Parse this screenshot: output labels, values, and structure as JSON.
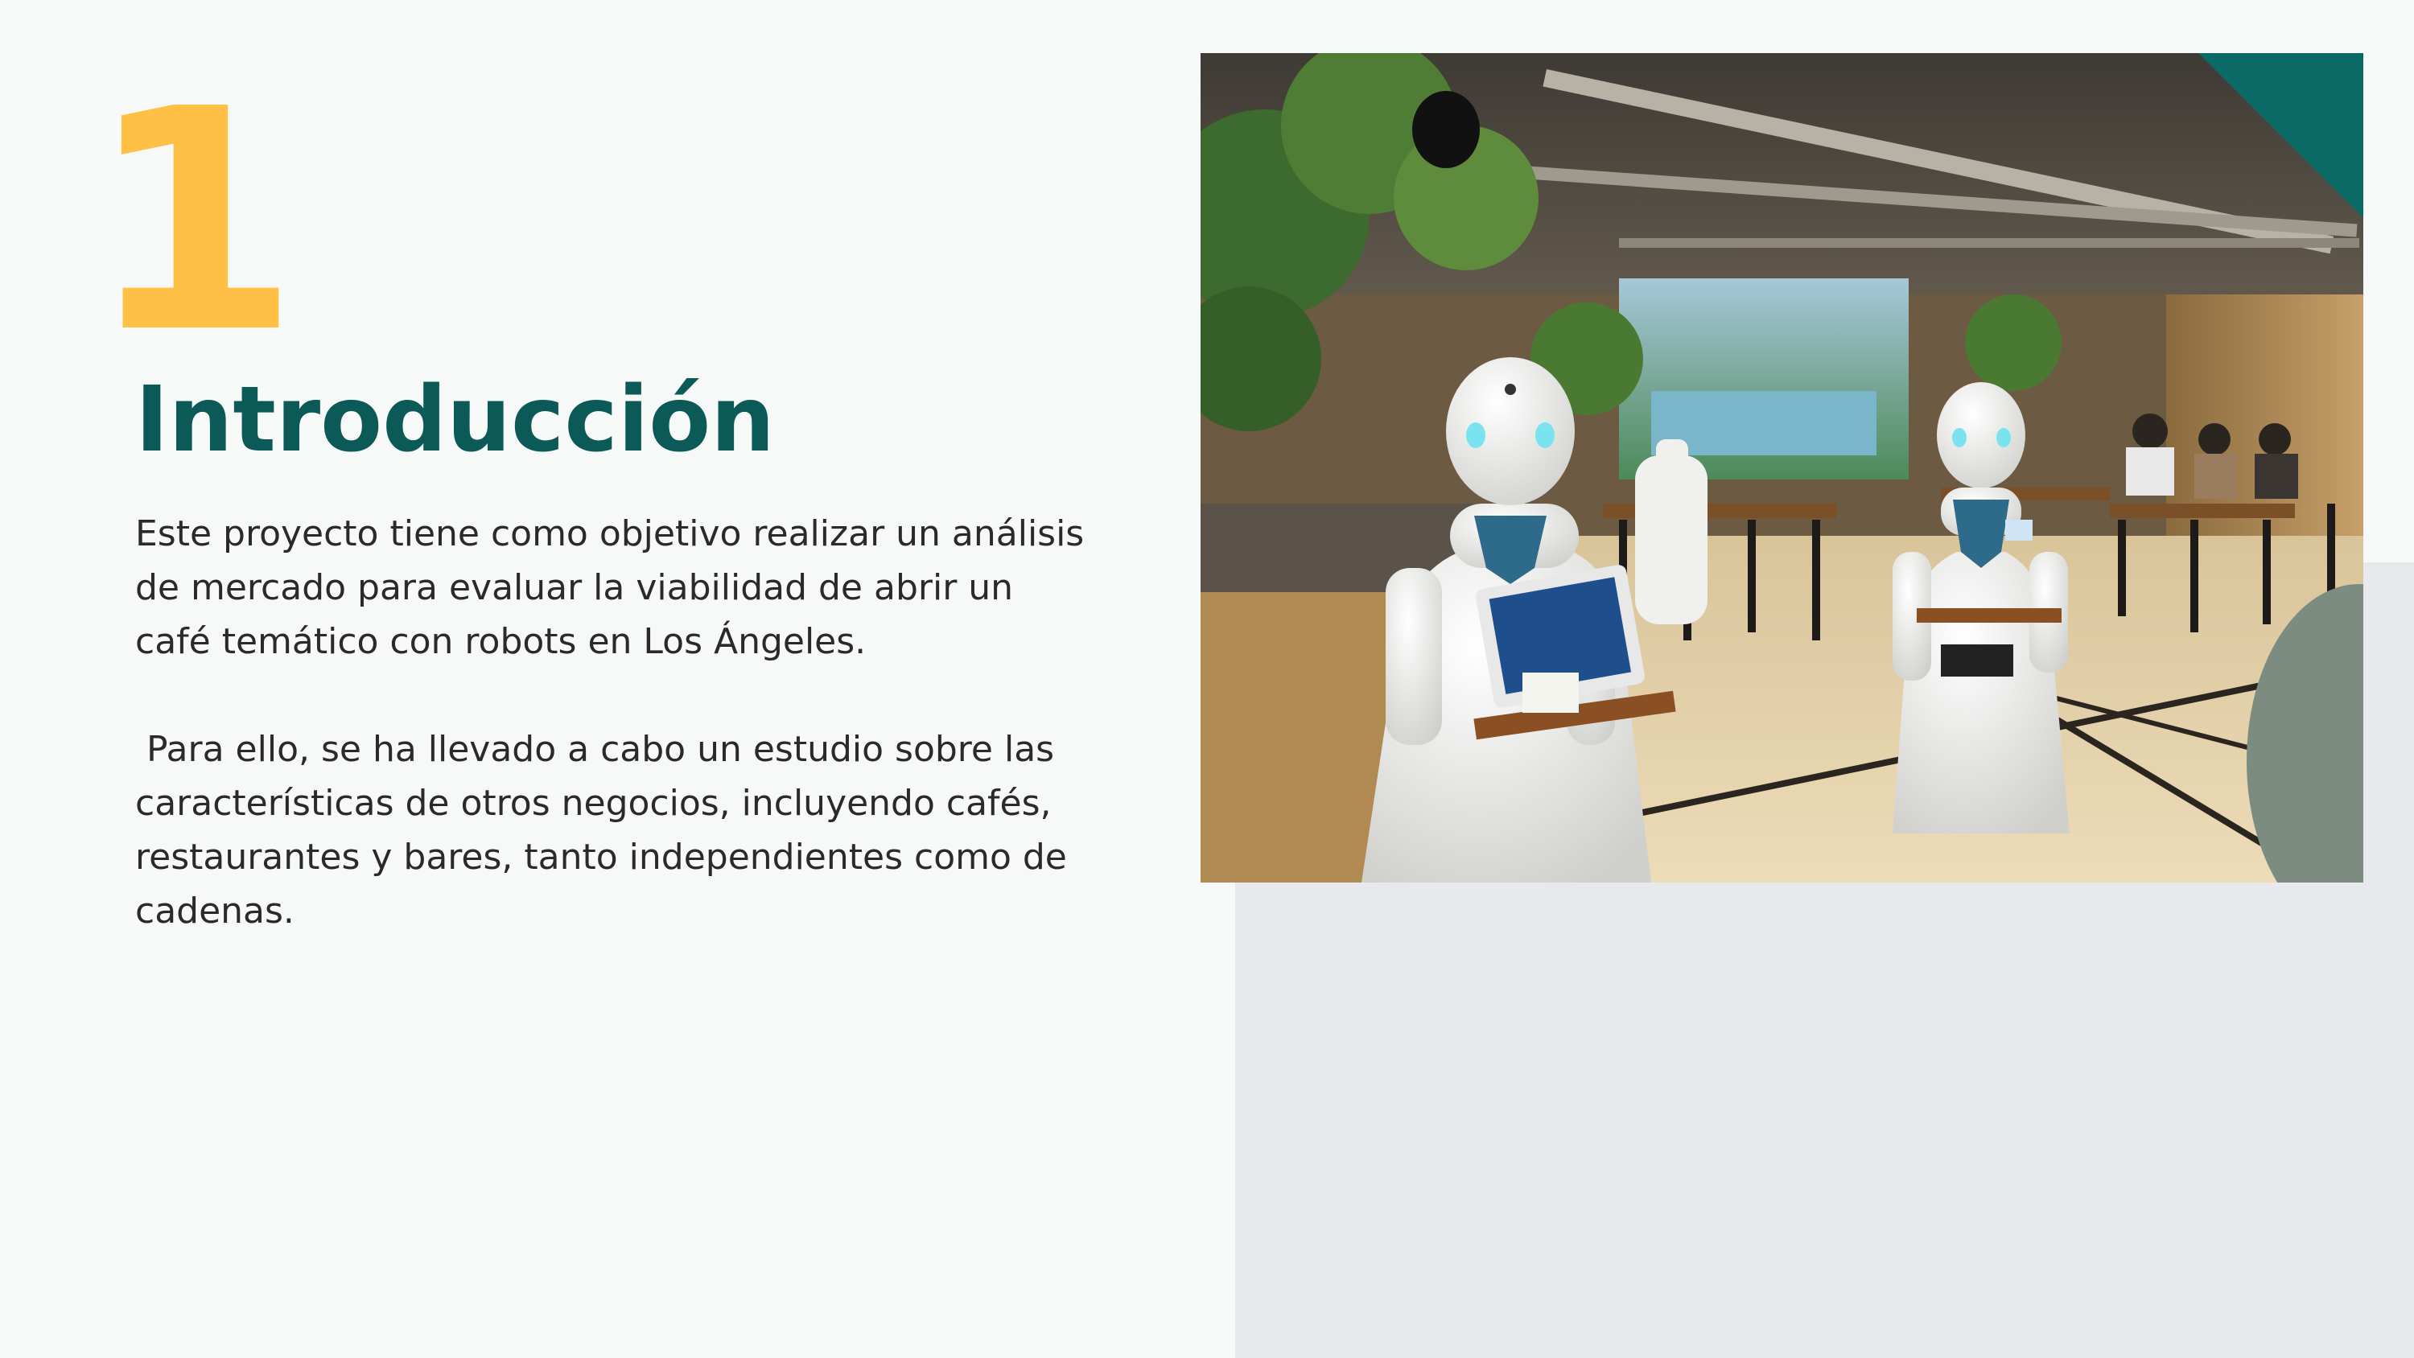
{
  "slide": {
    "number": "1",
    "title": "Introducción",
    "paragraphs": [
      "Este proyecto tiene como objetivo realizar un análisis de mercado para evaluar la viabilidad de abrir un café temático con robots en Los Ángeles.",
      " Para ello, se ha llevado a cabo un estudio sobre las características de otros negocios, incluyendo cafés, restaurantes y bares, tanto independientes como de cadenas."
    ]
  },
  "colors": {
    "accent_yellow": "#ffc145",
    "accent_teal": "#0b5a58",
    "background": "#f7f9f9",
    "panel": "#e8e9ec"
  }
}
